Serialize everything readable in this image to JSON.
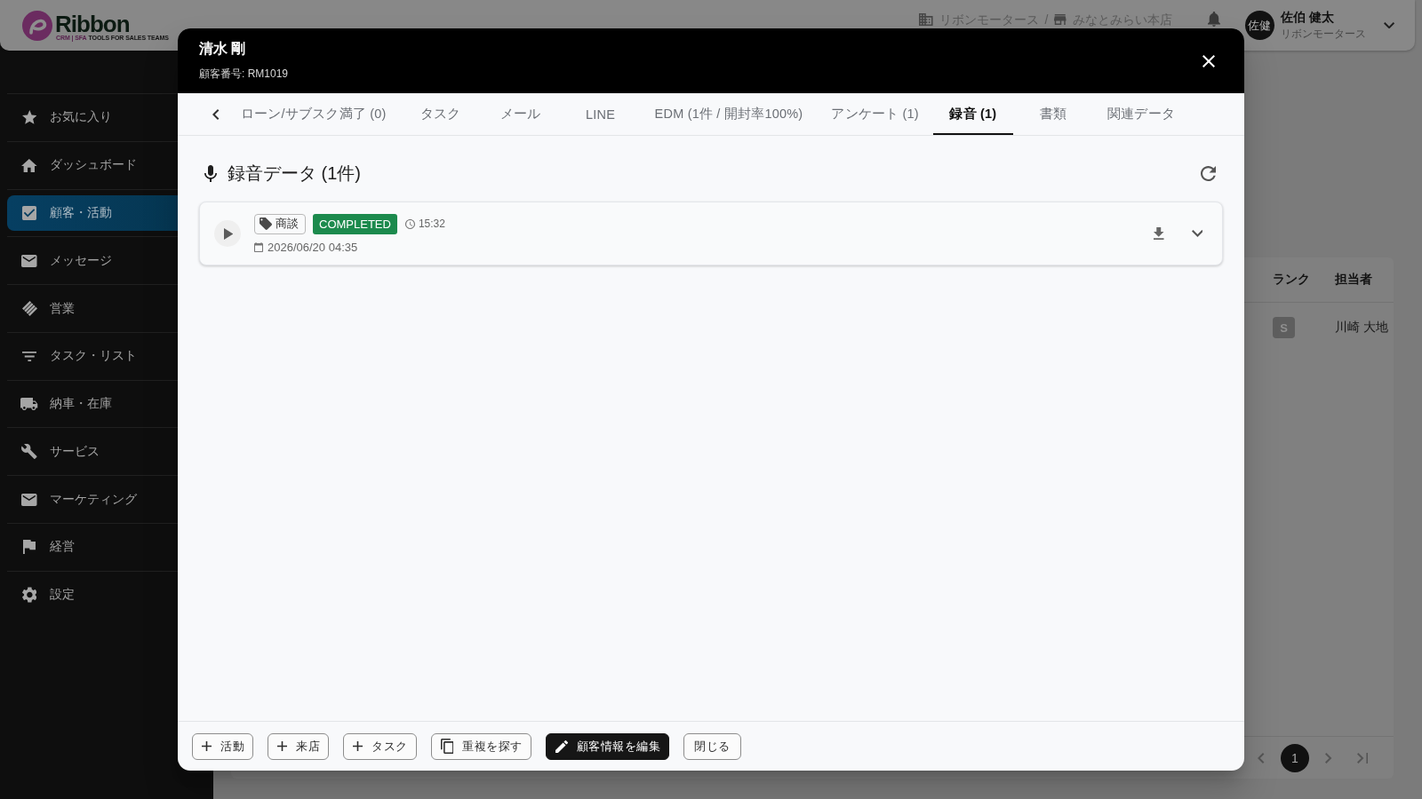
{
  "top_bar": {
    "logo": {
      "name": "Ribbon",
      "tagline_prefix": "CRM | SFA",
      "tagline": "TOOLS FOR SALES TEAMS"
    },
    "breadcrumb": [
      {
        "kind": "company",
        "label": "リボンモータース"
      },
      {
        "kind": "store",
        "label": "みなとみらい本店"
      }
    ],
    "breadcrumb_separator": "/",
    "user": {
      "initials": "佐健",
      "name": "佐伯 健太",
      "company": "リボンモータース"
    }
  },
  "sidebar": {
    "items": [
      {
        "kind": "favorites",
        "label": "お気に入り",
        "selected": false
      },
      {
        "kind": "dashboard",
        "label": "ダッシュボード",
        "selected": false
      },
      {
        "kind": "customers",
        "label": "顧客・活動",
        "selected": true
      },
      {
        "kind": "messages",
        "label": "メッセージ",
        "selected": false
      },
      {
        "kind": "sales",
        "label": "営業",
        "selected": false
      },
      {
        "kind": "tasks",
        "label": "タスク・リスト",
        "selected": false
      },
      {
        "kind": "delivery",
        "label": "納車・在庫",
        "selected": false
      },
      {
        "kind": "service",
        "label": "サービス",
        "selected": false
      },
      {
        "kind": "marketing",
        "label": "マーケティング",
        "selected": false
      },
      {
        "kind": "management",
        "label": "経営",
        "selected": false
      },
      {
        "kind": "settings",
        "label": "設定",
        "selected": false
      }
    ]
  },
  "customer_table": {
    "columns": [
      "ランク",
      "担当者"
    ],
    "rows": [
      {
        "rank": "S",
        "owner": "川崎 大地"
      }
    ],
    "pagination": {
      "pages": [
        {
          "label": "1",
          "selected": true
        }
      ]
    }
  },
  "customer_dialog": {
    "title": "清水 剛",
    "customer_number": "顧客番号: RM1019",
    "tabs": [
      {
        "label": "ローン/サブスク満了 (0)",
        "selected": false
      },
      {
        "label": "タスク",
        "selected": false
      },
      {
        "label": "メール",
        "selected": false
      },
      {
        "label": "LINE",
        "selected": false
      },
      {
        "label": "EDM (1件 / 開封率100%)",
        "selected": false
      },
      {
        "label": "アンケート (1)",
        "selected": false
      },
      {
        "label": "録音 (1)",
        "selected": true
      },
      {
        "label": "書類",
        "selected": false
      },
      {
        "label": "関連データ",
        "selected": false
      }
    ],
    "section_title": "録音データ (1件)",
    "recordings": [
      {
        "category": "商談",
        "status": {
          "label": "COMPLETED",
          "kind": "completed"
        },
        "duration": "15:32",
        "recorded_at": "2026/06/20 04:35",
        "expanded": false
      }
    ],
    "actions": [
      {
        "kind": "add",
        "label": "活動"
      },
      {
        "kind": "add",
        "label": "来店"
      },
      {
        "kind": "add",
        "label": "タスク"
      },
      {
        "kind": "duplicate",
        "label": "重複を探す"
      },
      {
        "kind": "edit",
        "label": "顧客情報を編集"
      },
      {
        "kind": "close",
        "label": "閉じる"
      }
    ]
  }
}
